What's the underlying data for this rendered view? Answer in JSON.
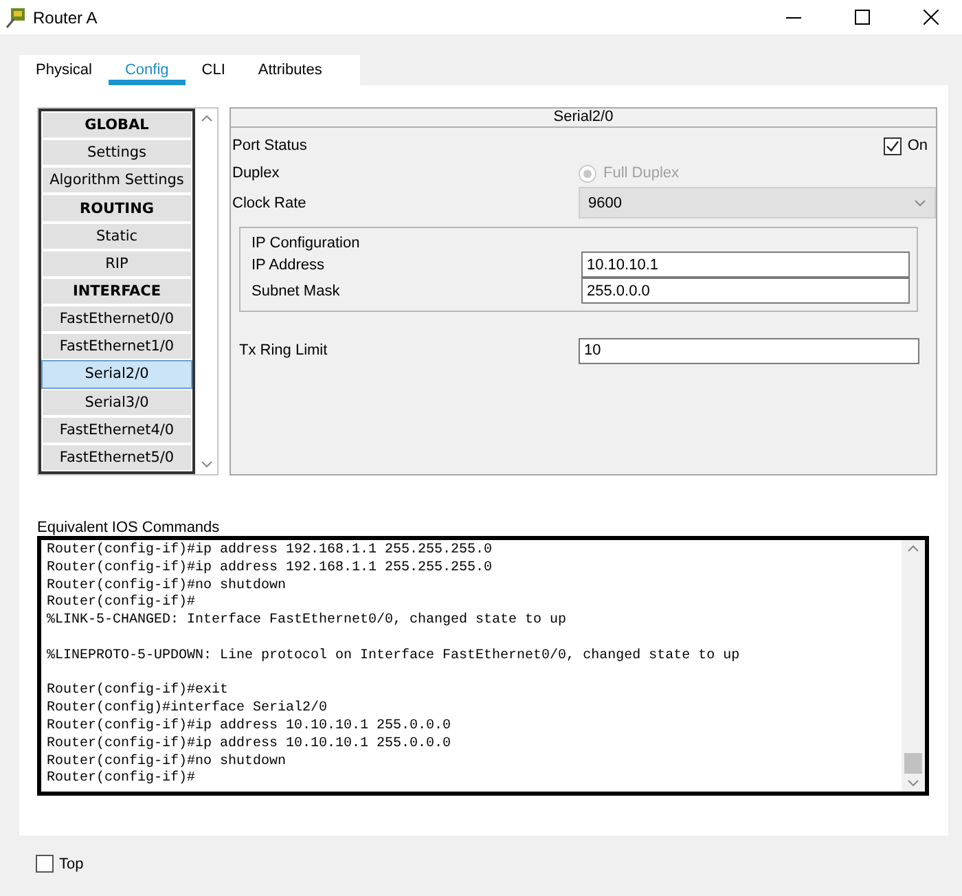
{
  "window": {
    "title": "Router A"
  },
  "tabs": [
    {
      "label": "Physical",
      "selected": false
    },
    {
      "label": "Config",
      "selected": true
    },
    {
      "label": "CLI",
      "selected": false
    },
    {
      "label": "Attributes",
      "selected": false
    }
  ],
  "sidebar": {
    "items": [
      {
        "label": "GLOBAL",
        "kind": "header",
        "selected": false
      },
      {
        "label": "Settings",
        "kind": "item",
        "selected": false
      },
      {
        "label": "Algorithm Settings",
        "kind": "item",
        "selected": false
      },
      {
        "label": "ROUTING",
        "kind": "header",
        "selected": false
      },
      {
        "label": "Static",
        "kind": "item",
        "selected": false
      },
      {
        "label": "RIP",
        "kind": "item",
        "selected": false
      },
      {
        "label": "INTERFACE",
        "kind": "header",
        "selected": false
      },
      {
        "label": "FastEthernet0/0",
        "kind": "item",
        "selected": false
      },
      {
        "label": "FastEthernet1/0",
        "kind": "item",
        "selected": false
      },
      {
        "label": "Serial2/0",
        "kind": "item",
        "selected": true
      },
      {
        "label": "Serial3/0",
        "kind": "item",
        "selected": false
      },
      {
        "label": "FastEthernet4/0",
        "kind": "item",
        "selected": false
      },
      {
        "label": "FastEthernet5/0",
        "kind": "item",
        "selected": false
      }
    ]
  },
  "panel": {
    "title": "Serial2/0",
    "port_status": {
      "label": "Port Status",
      "checkbox_label": "On",
      "checked": true
    },
    "duplex": {
      "label": "Duplex",
      "option": "Full Duplex",
      "selected": true,
      "disabled": true
    },
    "clock_rate": {
      "label": "Clock Rate",
      "value": "9600"
    },
    "ip_configuration": {
      "title": "IP Configuration",
      "fields": [
        {
          "label": "IP Address",
          "value": "10.10.10.1"
        },
        {
          "label": "Subnet Mask",
          "value": "255.0.0.0"
        }
      ]
    },
    "tx_ring_limit": {
      "label": "Tx Ring Limit",
      "value": "10"
    }
  },
  "console": {
    "label": "Equivalent IOS Commands",
    "lines": [
      {
        "kind": "text",
        "text": "Router(config-if)#ip address 192.168.1.1 255.255.255.0"
      },
      {
        "kind": "text",
        "text": "Router(config-if)#ip address 192.168.1.1 255.255.255.0"
      },
      {
        "kind": "text",
        "text": "Router(config-if)#no shutdown"
      },
      {
        "kind": "text",
        "text": "Router(config-if)#"
      },
      {
        "kind": "text",
        "text": "%LINK-5-CHANGED: Interface FastEthernet0/0, changed state to up"
      },
      {
        "kind": "blank"
      },
      {
        "kind": "text",
        "text": "%LINEPROTO-5-UPDOWN: Line protocol on Interface FastEthernet0/0, changed state to up"
      },
      {
        "kind": "blank"
      },
      {
        "kind": "text",
        "text": "Router(config-if)#exit"
      },
      {
        "kind": "text",
        "text": "Router(config)#interface Serial2/0"
      },
      {
        "kind": "text",
        "text": "Router(config-if)#ip address 10.10.10.1 255.0.0.0"
      },
      {
        "kind": "text",
        "text": "Router(config-if)#ip address 10.10.10.1 255.0.0.0"
      },
      {
        "kind": "text",
        "text": "Router(config-if)#no shutdown"
      },
      {
        "kind": "text",
        "text": "Router(config-if)#"
      }
    ]
  },
  "top": {
    "label": "Top",
    "checked": false
  }
}
